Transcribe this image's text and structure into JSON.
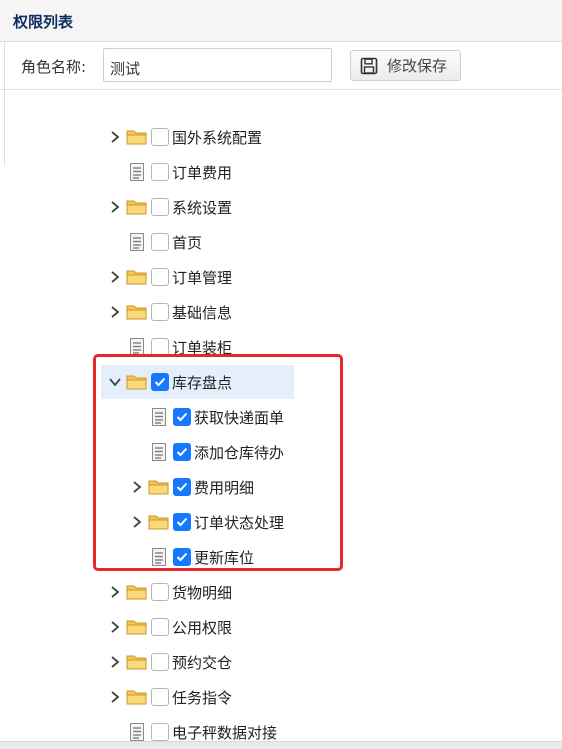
{
  "panel": {
    "title": "权限列表"
  },
  "toolbar": {
    "role_label": "角色名称:",
    "role_value": "测试",
    "save_label": "修改保存",
    "save_icon": "floppy-disk-icon"
  },
  "tree": {
    "nodes": [
      {
        "label": "国外系统配置",
        "type": "folder",
        "expanded": false,
        "checked": false,
        "depth": 0
      },
      {
        "label": "订单费用",
        "type": "leaf",
        "checked": false,
        "depth": 0
      },
      {
        "label": "系统设置",
        "type": "folder",
        "expanded": false,
        "checked": false,
        "depth": 0
      },
      {
        "label": "首页",
        "type": "leaf",
        "checked": false,
        "depth": 0
      },
      {
        "label": "订单管理",
        "type": "folder",
        "expanded": false,
        "checked": false,
        "depth": 0
      },
      {
        "label": "基础信息",
        "type": "folder",
        "expanded": false,
        "checked": false,
        "depth": 0
      },
      {
        "label": "订单装柜",
        "type": "leaf",
        "checked": false,
        "depth": 0
      },
      {
        "label": "库存盘点",
        "type": "folder",
        "expanded": true,
        "checked": true,
        "depth": 0,
        "selected": true
      },
      {
        "label": "获取快递面单",
        "type": "leaf",
        "checked": true,
        "depth": 1
      },
      {
        "label": "添加仓库待办",
        "type": "leaf",
        "checked": true,
        "depth": 1
      },
      {
        "label": "费用明细",
        "type": "folder",
        "expanded": false,
        "checked": true,
        "depth": 1
      },
      {
        "label": "订单状态处理",
        "type": "folder",
        "expanded": false,
        "checked": true,
        "depth": 1
      },
      {
        "label": "更新库位",
        "type": "leaf",
        "checked": true,
        "depth": 1
      },
      {
        "label": "货物明细",
        "type": "folder",
        "expanded": false,
        "checked": false,
        "depth": 0
      },
      {
        "label": "公用权限",
        "type": "folder",
        "expanded": false,
        "checked": false,
        "depth": 0
      },
      {
        "label": "预约交仓",
        "type": "folder",
        "expanded": false,
        "checked": false,
        "depth": 0
      },
      {
        "label": "任务指令",
        "type": "folder",
        "expanded": false,
        "checked": false,
        "depth": 0
      },
      {
        "label": "电子秤数据对接",
        "type": "leaf",
        "checked": false,
        "depth": 0
      }
    ]
  },
  "colors": {
    "accent": "#1677ff",
    "highlight_border": "#e8262d",
    "folder": "#f5c84c",
    "selected_bg": "#e5eefb",
    "title": "#0e2d5f"
  }
}
